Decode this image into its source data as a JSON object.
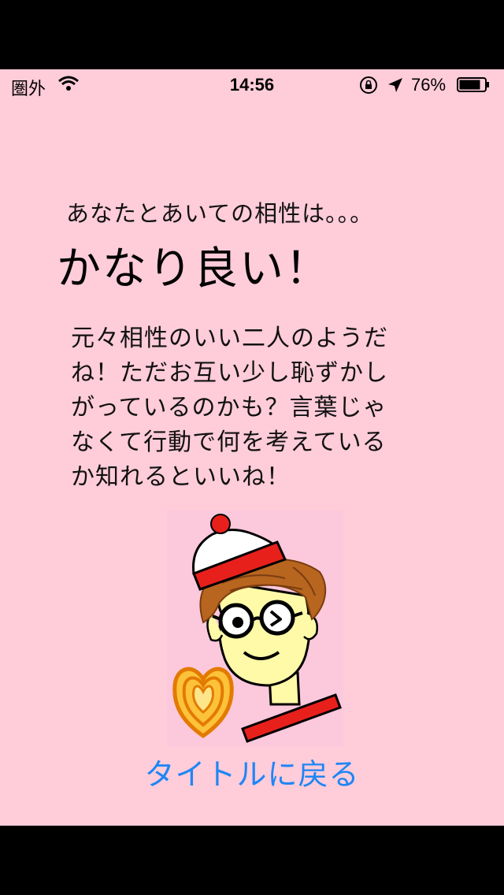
{
  "status_bar": {
    "carrier": "圏外",
    "time": "14:56",
    "battery": "76%"
  },
  "intro_text": "あなたとあいての相性は。。。",
  "result_text": "かなり良い！",
  "description_lines": [
    "元々相性のいい二人のようだ",
    "ね！ただお互い少し恥ずかし",
    "がっているのかも？言葉じゃ",
    "なくて行動で何を考えている",
    "か知れるといいね！"
  ],
  "back_button": "タイトルに戻る",
  "colors": {
    "background": "#ffccda",
    "link": "#1e86f5",
    "hat_red": "#e8201c",
    "heart": "#f7a21a",
    "skin": "#fffaa8",
    "hair": "#b8651f"
  }
}
